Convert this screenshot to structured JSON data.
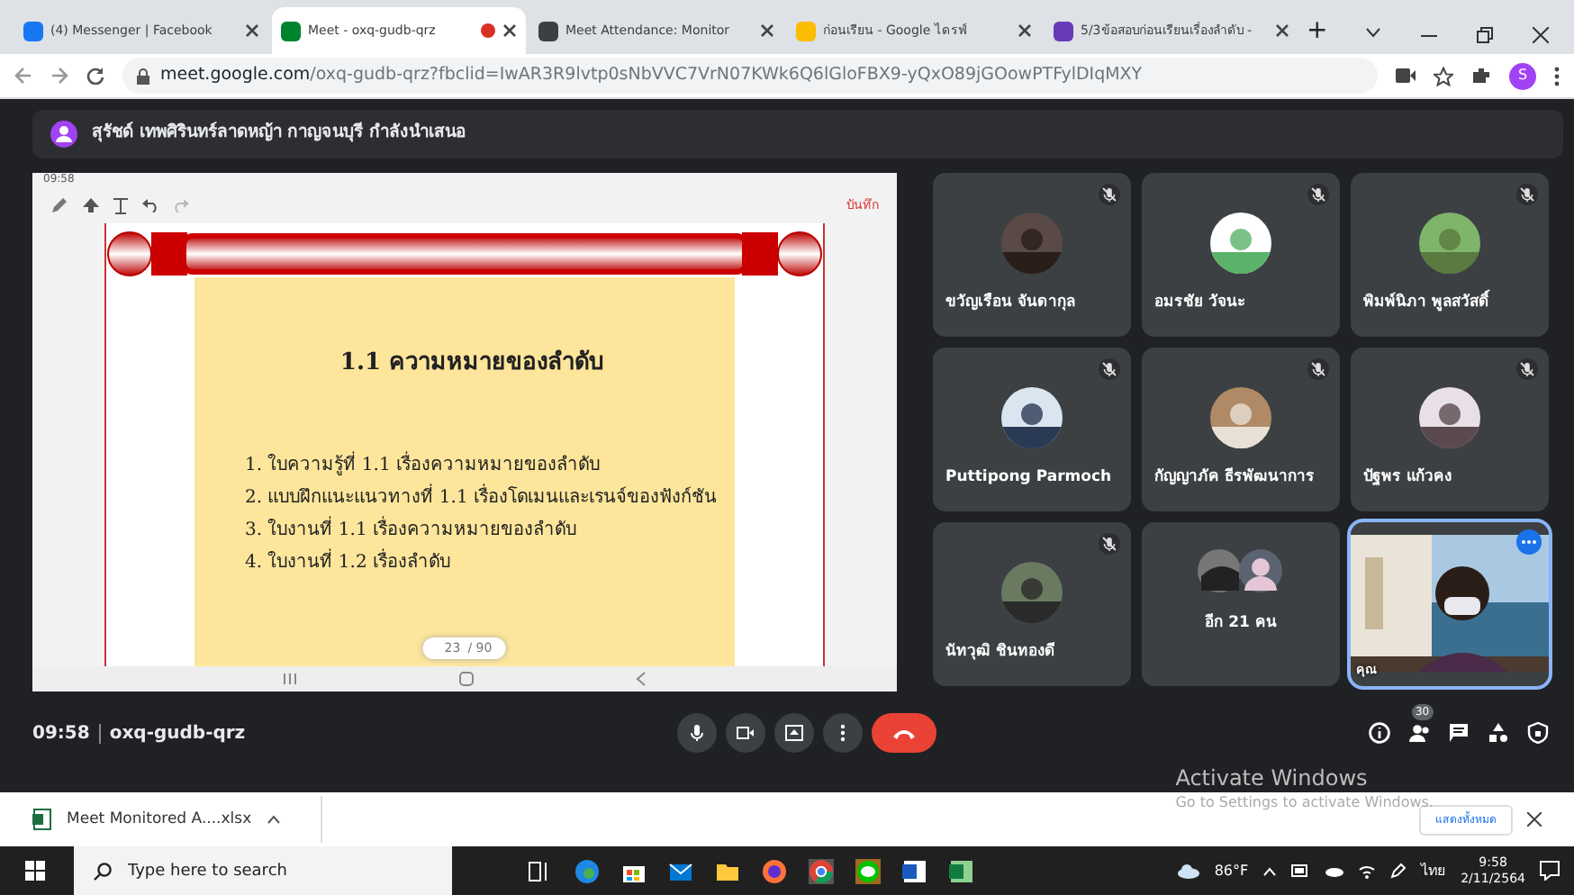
{
  "browser": {
    "tabs": [
      {
        "title": "(4) Messenger | Facebook",
        "selected": false,
        "recording": false,
        "color": "#1877f2"
      },
      {
        "title": "Meet - oxq-gudb-qrz",
        "selected": true,
        "recording": true,
        "color": "#00832d"
      },
      {
        "title": "Meet Attendance: Monitor",
        "selected": false,
        "recording": false,
        "color": "#3c4043"
      },
      {
        "title": "ก่อนเรียน - Google ไดรฟ์",
        "selected": false,
        "recording": false,
        "color": "#fbbc04"
      },
      {
        "title": "5/3ข้อสอบก่อนเรียนเรื่องลำดับ -",
        "selected": false,
        "recording": false,
        "color": "#673ab7"
      }
    ],
    "new_tab": "+",
    "url_host": "meet.google.com",
    "url_path": "/oxq-gudb-qrz?fbclid=IwAR3R9lvtp0sNbVVC7VrN07KWk6Q6lGloFBX9-yQxO89jGOowPTFylDIqMXY",
    "profile_initial": "S"
  },
  "presenter_banner": "สุรัชด์ เทพศิรินทร์ลาดหญ้า กาญจนบุรี กำลังนำเสนอ",
  "slide": {
    "status_time": "09:58",
    "save_label": "บันทึก",
    "title": "1.1 ความหมายของลำดับ",
    "items": [
      "1. ใบความรู้ที่ 1.1 เรื่องความหมายของลำดับ",
      "2. แบบฝึกแนะแนวทางที่ 1.1 เรื่องโดเมนและเรนจ์ของฟังก์ชัน",
      "3. ใบงานที่ 1.1 เรื่องความหมายของลำดับ",
      "4. ใบงานที่ 1.2 เรื่องลำดับ"
    ],
    "page": "23",
    "page_total": "/ 90"
  },
  "participants": [
    {
      "name": "ขวัญเรือน จันดากุล",
      "kind": "avatar",
      "muted": true,
      "highlighted": false
    },
    {
      "name": "อมรชัย วัจนะ",
      "kind": "avatar",
      "muted": true,
      "highlighted": false
    },
    {
      "name": "พิมพ์นิภา พูลสวัสดิ์",
      "kind": "avatar",
      "muted": true,
      "highlighted": false
    },
    {
      "name": "Puttipong Parmoch",
      "kind": "avatar",
      "muted": true,
      "highlighted": false
    },
    {
      "name": "กัญญาภัค ธีรพัฒนาการ",
      "kind": "avatar",
      "muted": true,
      "highlighted": false
    },
    {
      "name": "ปัฐพร แก้วคง",
      "kind": "avatar",
      "muted": true,
      "highlighted": false
    },
    {
      "name": "นัทวุฒิ ชินทองดี",
      "kind": "avatar",
      "muted": true,
      "highlighted": false
    },
    {
      "name": "อีก 21 คน",
      "kind": "others",
      "muted": false,
      "highlighted": false
    },
    {
      "name": "คุณ",
      "kind": "self",
      "muted": false,
      "highlighted": true
    }
  ],
  "meeting": {
    "time": "09:58",
    "code": "oxq-gudb-qrz",
    "people_count": "30"
  },
  "activation": {
    "title": "Activate Windows",
    "hint": "Go to Settings to activate Windows."
  },
  "download": {
    "file": "Meet Monitored A....xlsx",
    "show_all": "แสดงทั้งหมด"
  },
  "taskbar": {
    "search_placeholder": "Type here to search",
    "weather": "86°F",
    "language": "ไทย",
    "time": "9:58",
    "date": "2/11/2564"
  }
}
